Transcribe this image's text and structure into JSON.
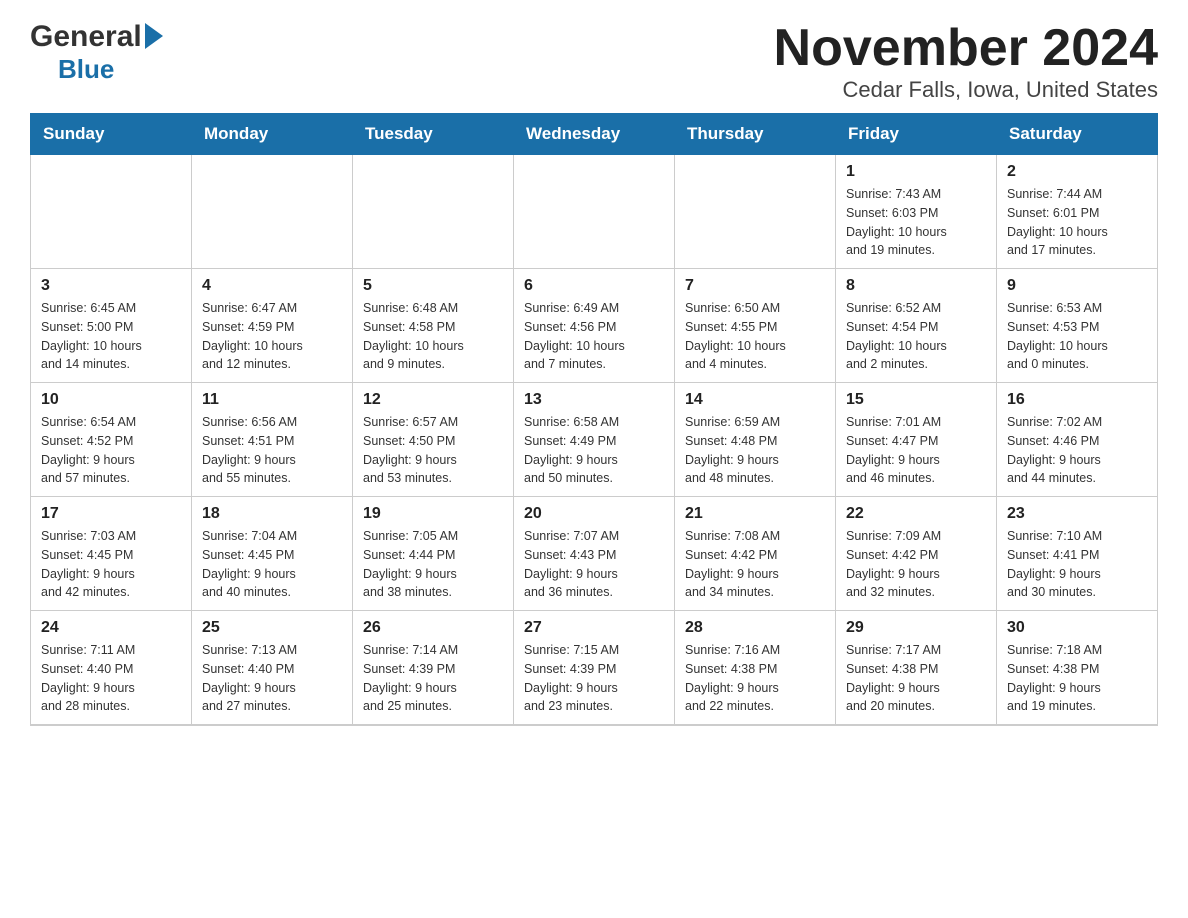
{
  "logo": {
    "general": "General",
    "blue": "Blue"
  },
  "title": "November 2024",
  "subtitle": "Cedar Falls, Iowa, United States",
  "weekdays": [
    "Sunday",
    "Monday",
    "Tuesday",
    "Wednesday",
    "Thursday",
    "Friday",
    "Saturday"
  ],
  "weeks": [
    [
      {
        "day": "",
        "info": ""
      },
      {
        "day": "",
        "info": ""
      },
      {
        "day": "",
        "info": ""
      },
      {
        "day": "",
        "info": ""
      },
      {
        "day": "",
        "info": ""
      },
      {
        "day": "1",
        "info": "Sunrise: 7:43 AM\nSunset: 6:03 PM\nDaylight: 10 hours\nand 19 minutes."
      },
      {
        "day": "2",
        "info": "Sunrise: 7:44 AM\nSunset: 6:01 PM\nDaylight: 10 hours\nand 17 minutes."
      }
    ],
    [
      {
        "day": "3",
        "info": "Sunrise: 6:45 AM\nSunset: 5:00 PM\nDaylight: 10 hours\nand 14 minutes."
      },
      {
        "day": "4",
        "info": "Sunrise: 6:47 AM\nSunset: 4:59 PM\nDaylight: 10 hours\nand 12 minutes."
      },
      {
        "day": "5",
        "info": "Sunrise: 6:48 AM\nSunset: 4:58 PM\nDaylight: 10 hours\nand 9 minutes."
      },
      {
        "day": "6",
        "info": "Sunrise: 6:49 AM\nSunset: 4:56 PM\nDaylight: 10 hours\nand 7 minutes."
      },
      {
        "day": "7",
        "info": "Sunrise: 6:50 AM\nSunset: 4:55 PM\nDaylight: 10 hours\nand 4 minutes."
      },
      {
        "day": "8",
        "info": "Sunrise: 6:52 AM\nSunset: 4:54 PM\nDaylight: 10 hours\nand 2 minutes."
      },
      {
        "day": "9",
        "info": "Sunrise: 6:53 AM\nSunset: 4:53 PM\nDaylight: 10 hours\nand 0 minutes."
      }
    ],
    [
      {
        "day": "10",
        "info": "Sunrise: 6:54 AM\nSunset: 4:52 PM\nDaylight: 9 hours\nand 57 minutes."
      },
      {
        "day": "11",
        "info": "Sunrise: 6:56 AM\nSunset: 4:51 PM\nDaylight: 9 hours\nand 55 minutes."
      },
      {
        "day": "12",
        "info": "Sunrise: 6:57 AM\nSunset: 4:50 PM\nDaylight: 9 hours\nand 53 minutes."
      },
      {
        "day": "13",
        "info": "Sunrise: 6:58 AM\nSunset: 4:49 PM\nDaylight: 9 hours\nand 50 minutes."
      },
      {
        "day": "14",
        "info": "Sunrise: 6:59 AM\nSunset: 4:48 PM\nDaylight: 9 hours\nand 48 minutes."
      },
      {
        "day": "15",
        "info": "Sunrise: 7:01 AM\nSunset: 4:47 PM\nDaylight: 9 hours\nand 46 minutes."
      },
      {
        "day": "16",
        "info": "Sunrise: 7:02 AM\nSunset: 4:46 PM\nDaylight: 9 hours\nand 44 minutes."
      }
    ],
    [
      {
        "day": "17",
        "info": "Sunrise: 7:03 AM\nSunset: 4:45 PM\nDaylight: 9 hours\nand 42 minutes."
      },
      {
        "day": "18",
        "info": "Sunrise: 7:04 AM\nSunset: 4:45 PM\nDaylight: 9 hours\nand 40 minutes."
      },
      {
        "day": "19",
        "info": "Sunrise: 7:05 AM\nSunset: 4:44 PM\nDaylight: 9 hours\nand 38 minutes."
      },
      {
        "day": "20",
        "info": "Sunrise: 7:07 AM\nSunset: 4:43 PM\nDaylight: 9 hours\nand 36 minutes."
      },
      {
        "day": "21",
        "info": "Sunrise: 7:08 AM\nSunset: 4:42 PM\nDaylight: 9 hours\nand 34 minutes."
      },
      {
        "day": "22",
        "info": "Sunrise: 7:09 AM\nSunset: 4:42 PM\nDaylight: 9 hours\nand 32 minutes."
      },
      {
        "day": "23",
        "info": "Sunrise: 7:10 AM\nSunset: 4:41 PM\nDaylight: 9 hours\nand 30 minutes."
      }
    ],
    [
      {
        "day": "24",
        "info": "Sunrise: 7:11 AM\nSunset: 4:40 PM\nDaylight: 9 hours\nand 28 minutes."
      },
      {
        "day": "25",
        "info": "Sunrise: 7:13 AM\nSunset: 4:40 PM\nDaylight: 9 hours\nand 27 minutes."
      },
      {
        "day": "26",
        "info": "Sunrise: 7:14 AM\nSunset: 4:39 PM\nDaylight: 9 hours\nand 25 minutes."
      },
      {
        "day": "27",
        "info": "Sunrise: 7:15 AM\nSunset: 4:39 PM\nDaylight: 9 hours\nand 23 minutes."
      },
      {
        "day": "28",
        "info": "Sunrise: 7:16 AM\nSunset: 4:38 PM\nDaylight: 9 hours\nand 22 minutes."
      },
      {
        "day": "29",
        "info": "Sunrise: 7:17 AM\nSunset: 4:38 PM\nDaylight: 9 hours\nand 20 minutes."
      },
      {
        "day": "30",
        "info": "Sunrise: 7:18 AM\nSunset: 4:38 PM\nDaylight: 9 hours\nand 19 minutes."
      }
    ]
  ]
}
